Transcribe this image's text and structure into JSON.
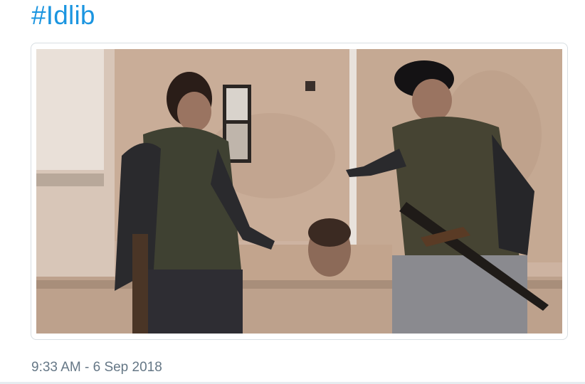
{
  "tweet": {
    "hashtag": "#Idlib",
    "timestamp": "9:33 AM - 6 Sep 2018"
  },
  "media": {
    "type": "photo"
  },
  "colors": {
    "link": "#1b95e0",
    "meta_text": "#657786",
    "card_border": "#d8dee2"
  }
}
